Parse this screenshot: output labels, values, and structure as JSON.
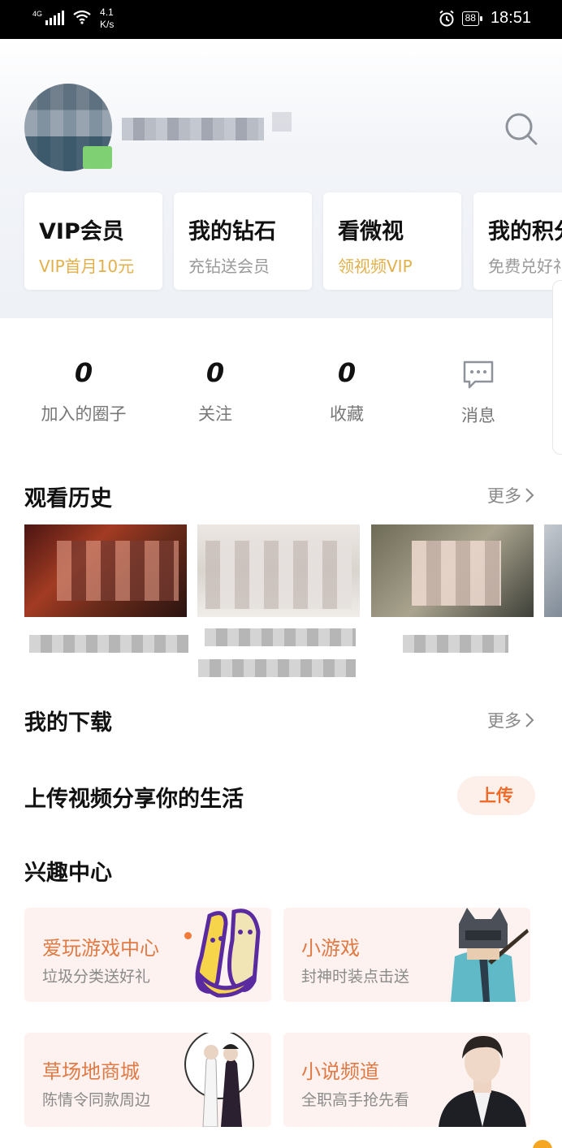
{
  "status_bar": {
    "network": "4G",
    "speed": "4.1\nK/s",
    "battery": "88",
    "time": "18:51"
  },
  "vip_cards": [
    {
      "title": "VIP会员",
      "subtitle": "VIP首月10元",
      "subtitle_color": "gold"
    },
    {
      "title": "我的钻石",
      "subtitle": "充钻送会员",
      "subtitle_color": "grey"
    },
    {
      "title": "看微视",
      "subtitle": "领视频VIP",
      "subtitle_color": "gold"
    },
    {
      "title": "我的积分",
      "subtitle": "免费兑好礼",
      "subtitle_color": "grey"
    }
  ],
  "stats": [
    {
      "value": "0",
      "label": "加入的圈子"
    },
    {
      "value": "0",
      "label": "关注"
    },
    {
      "value": "0",
      "label": "收藏"
    },
    {
      "value": "",
      "label": "消息",
      "icon": "message-icon"
    }
  ],
  "history": {
    "title": "观看历史",
    "more": "更多"
  },
  "downloads": {
    "title": "我的下载",
    "more": "更多"
  },
  "upload": {
    "title": "上传视频分享你的生活",
    "button": "上传"
  },
  "interest": {
    "title": "兴趣中心",
    "tiles": [
      {
        "title": "爱玩游戏中心",
        "subtitle": "垃圾分类送好礼"
      },
      {
        "title": "小游戏",
        "subtitle": "封神时装点击送"
      },
      {
        "title": "草场地商城",
        "subtitle": "陈情令同款周边"
      },
      {
        "title": "小说频道",
        "subtitle": "全职高手抢先看"
      }
    ]
  },
  "colors": {
    "accent": "#f06a2a",
    "gold": "#e2b04a",
    "tile_bg": "#fdf2ef"
  }
}
